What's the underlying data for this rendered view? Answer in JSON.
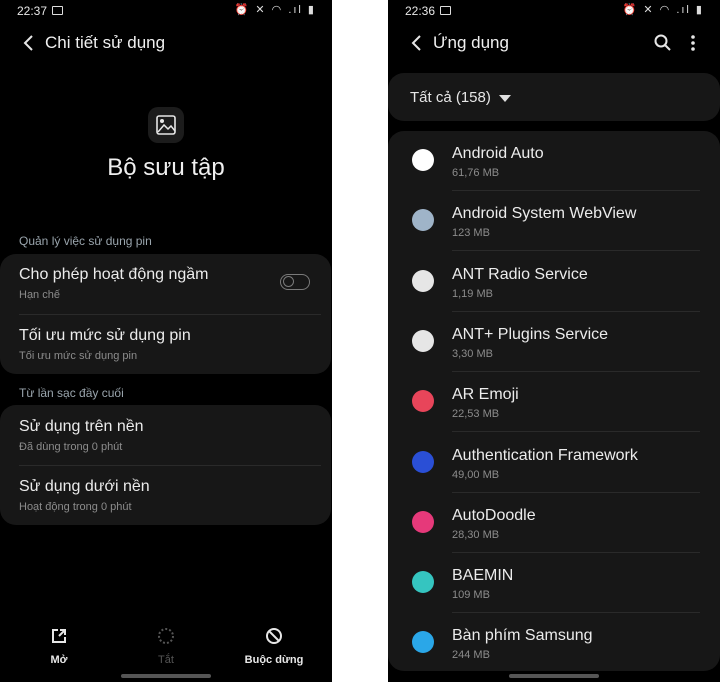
{
  "left": {
    "status": {
      "time": "22:37",
      "icons": "⏰ ✕ ◠ .ıl ▮"
    },
    "header": {
      "title": "Chi tiết sử dụng"
    },
    "app": {
      "name": "Bộ sưu tập",
      "icon": "gallery-icon"
    },
    "battery_section": {
      "heading": "Quản lý việc sử dụng pin",
      "rows": [
        {
          "title": "Cho phép hoạt động ngầm",
          "subtitle": "Hạn chế",
          "toggle_on": false
        },
        {
          "title": "Tối ưu mức sử dụng pin",
          "subtitle": "Tối ưu mức sử dụng pin"
        }
      ]
    },
    "charge_section": {
      "heading": "Từ lần sạc đầy cuối",
      "rows": [
        {
          "title": "Sử dụng trên nền",
          "subtitle": "Đã dùng trong 0 phút"
        },
        {
          "title": "Sử dụng dưới nền",
          "subtitle": "Hoạt động trong 0 phút"
        }
      ]
    },
    "bottom_nav": [
      {
        "label": "Mở",
        "icon": "open-external-icon",
        "enabled": true
      },
      {
        "label": "Tắt",
        "icon": "disable-icon",
        "enabled": false
      },
      {
        "label": "Buộc dừng",
        "icon": "force-stop-icon",
        "enabled": true
      }
    ]
  },
  "right": {
    "status": {
      "time": "22:36",
      "icons": "⏰ ✕ ◠ .ıl ▮"
    },
    "header": {
      "title": "Ứng dụng"
    },
    "filter": {
      "label": "Tất cả (158)"
    },
    "apps": [
      {
        "name": "Android Auto",
        "size": "61,76 MB",
        "color": "#ffffff"
      },
      {
        "name": "Android System WebView",
        "size": "123 MB",
        "color": "#9fb4c8"
      },
      {
        "name": "ANT Radio Service",
        "size": "1,19 MB",
        "color": "#e6e6e6"
      },
      {
        "name": "ANT+ Plugins Service",
        "size": "3,30 MB",
        "color": "#e6e6e6"
      },
      {
        "name": "AR Emoji",
        "size": "22,53 MB",
        "color": "#e8455a"
      },
      {
        "name": "Authentication Framework",
        "size": "49,00 MB",
        "color": "#2a4fd6"
      },
      {
        "name": "AutoDoodle",
        "size": "28,30 MB",
        "color": "#e6397a"
      },
      {
        "name": "BAEMIN",
        "size": "109 MB",
        "color": "#35c5c0"
      },
      {
        "name": "Bàn phím Samsung",
        "size": "244 MB",
        "color": "#2aa7e8"
      }
    ]
  }
}
